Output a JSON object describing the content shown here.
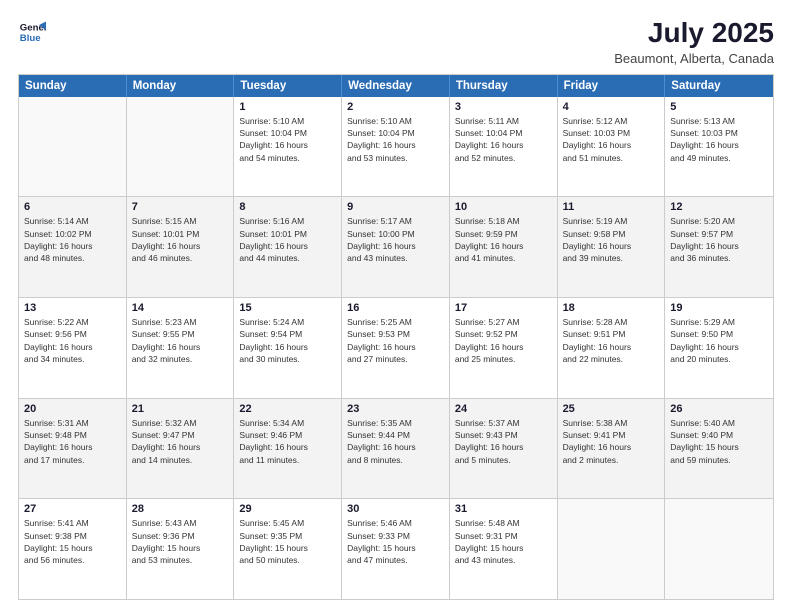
{
  "header": {
    "logo_line1": "General",
    "logo_line2": "Blue",
    "month": "July 2025",
    "location": "Beaumont, Alberta, Canada"
  },
  "weekdays": [
    "Sunday",
    "Monday",
    "Tuesday",
    "Wednesday",
    "Thursday",
    "Friday",
    "Saturday"
  ],
  "rows": [
    [
      {
        "day": "",
        "text": "",
        "empty": true
      },
      {
        "day": "",
        "text": "",
        "empty": true
      },
      {
        "day": "1",
        "text": "Sunrise: 5:10 AM\nSunset: 10:04 PM\nDaylight: 16 hours\nand 54 minutes."
      },
      {
        "day": "2",
        "text": "Sunrise: 5:10 AM\nSunset: 10:04 PM\nDaylight: 16 hours\nand 53 minutes."
      },
      {
        "day": "3",
        "text": "Sunrise: 5:11 AM\nSunset: 10:04 PM\nDaylight: 16 hours\nand 52 minutes."
      },
      {
        "day": "4",
        "text": "Sunrise: 5:12 AM\nSunset: 10:03 PM\nDaylight: 16 hours\nand 51 minutes."
      },
      {
        "day": "5",
        "text": "Sunrise: 5:13 AM\nSunset: 10:03 PM\nDaylight: 16 hours\nand 49 minutes."
      }
    ],
    [
      {
        "day": "6",
        "text": "Sunrise: 5:14 AM\nSunset: 10:02 PM\nDaylight: 16 hours\nand 48 minutes."
      },
      {
        "day": "7",
        "text": "Sunrise: 5:15 AM\nSunset: 10:01 PM\nDaylight: 16 hours\nand 46 minutes."
      },
      {
        "day": "8",
        "text": "Sunrise: 5:16 AM\nSunset: 10:01 PM\nDaylight: 16 hours\nand 44 minutes."
      },
      {
        "day": "9",
        "text": "Sunrise: 5:17 AM\nSunset: 10:00 PM\nDaylight: 16 hours\nand 43 minutes."
      },
      {
        "day": "10",
        "text": "Sunrise: 5:18 AM\nSunset: 9:59 PM\nDaylight: 16 hours\nand 41 minutes."
      },
      {
        "day": "11",
        "text": "Sunrise: 5:19 AM\nSunset: 9:58 PM\nDaylight: 16 hours\nand 39 minutes."
      },
      {
        "day": "12",
        "text": "Sunrise: 5:20 AM\nSunset: 9:57 PM\nDaylight: 16 hours\nand 36 minutes."
      }
    ],
    [
      {
        "day": "13",
        "text": "Sunrise: 5:22 AM\nSunset: 9:56 PM\nDaylight: 16 hours\nand 34 minutes."
      },
      {
        "day": "14",
        "text": "Sunrise: 5:23 AM\nSunset: 9:55 PM\nDaylight: 16 hours\nand 32 minutes."
      },
      {
        "day": "15",
        "text": "Sunrise: 5:24 AM\nSunset: 9:54 PM\nDaylight: 16 hours\nand 30 minutes."
      },
      {
        "day": "16",
        "text": "Sunrise: 5:25 AM\nSunset: 9:53 PM\nDaylight: 16 hours\nand 27 minutes."
      },
      {
        "day": "17",
        "text": "Sunrise: 5:27 AM\nSunset: 9:52 PM\nDaylight: 16 hours\nand 25 minutes."
      },
      {
        "day": "18",
        "text": "Sunrise: 5:28 AM\nSunset: 9:51 PM\nDaylight: 16 hours\nand 22 minutes."
      },
      {
        "day": "19",
        "text": "Sunrise: 5:29 AM\nSunset: 9:50 PM\nDaylight: 16 hours\nand 20 minutes."
      }
    ],
    [
      {
        "day": "20",
        "text": "Sunrise: 5:31 AM\nSunset: 9:48 PM\nDaylight: 16 hours\nand 17 minutes."
      },
      {
        "day": "21",
        "text": "Sunrise: 5:32 AM\nSunset: 9:47 PM\nDaylight: 16 hours\nand 14 minutes."
      },
      {
        "day": "22",
        "text": "Sunrise: 5:34 AM\nSunset: 9:46 PM\nDaylight: 16 hours\nand 11 minutes."
      },
      {
        "day": "23",
        "text": "Sunrise: 5:35 AM\nSunset: 9:44 PM\nDaylight: 16 hours\nand 8 minutes."
      },
      {
        "day": "24",
        "text": "Sunrise: 5:37 AM\nSunset: 9:43 PM\nDaylight: 16 hours\nand 5 minutes."
      },
      {
        "day": "25",
        "text": "Sunrise: 5:38 AM\nSunset: 9:41 PM\nDaylight: 16 hours\nand 2 minutes."
      },
      {
        "day": "26",
        "text": "Sunrise: 5:40 AM\nSunset: 9:40 PM\nDaylight: 15 hours\nand 59 minutes."
      }
    ],
    [
      {
        "day": "27",
        "text": "Sunrise: 5:41 AM\nSunset: 9:38 PM\nDaylight: 15 hours\nand 56 minutes."
      },
      {
        "day": "28",
        "text": "Sunrise: 5:43 AM\nSunset: 9:36 PM\nDaylight: 15 hours\nand 53 minutes."
      },
      {
        "day": "29",
        "text": "Sunrise: 5:45 AM\nSunset: 9:35 PM\nDaylight: 15 hours\nand 50 minutes."
      },
      {
        "day": "30",
        "text": "Sunrise: 5:46 AM\nSunset: 9:33 PM\nDaylight: 15 hours\nand 47 minutes."
      },
      {
        "day": "31",
        "text": "Sunrise: 5:48 AM\nSunset: 9:31 PM\nDaylight: 15 hours\nand 43 minutes."
      },
      {
        "day": "",
        "text": "",
        "empty": true
      },
      {
        "day": "",
        "text": "",
        "empty": true
      }
    ]
  ]
}
